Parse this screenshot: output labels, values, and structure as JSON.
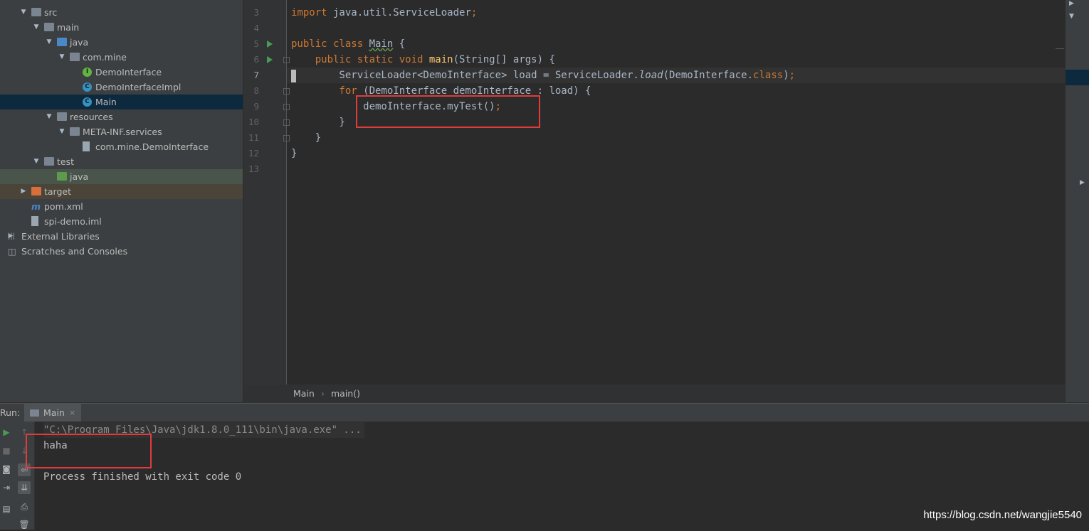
{
  "project_tree": [
    {
      "label": "src",
      "indent": 1,
      "type": "folder",
      "arrow": "down"
    },
    {
      "label": "main",
      "indent": 2,
      "type": "folder",
      "arrow": "down"
    },
    {
      "label": "java",
      "indent": 3,
      "type": "folder-blue",
      "arrow": "down"
    },
    {
      "label": "com.mine",
      "indent": 4,
      "type": "package",
      "arrow": "down"
    },
    {
      "label": "DemoInterface",
      "indent": 5,
      "type": "interface"
    },
    {
      "label": "DemoInterfaceImpl",
      "indent": 5,
      "type": "class"
    },
    {
      "label": "Main",
      "indent": 5,
      "type": "class-main",
      "selected": true
    },
    {
      "label": "resources",
      "indent": 3,
      "type": "folder",
      "arrow": "down"
    },
    {
      "label": "META-INF.services",
      "indent": 4,
      "type": "folder",
      "arrow": "down"
    },
    {
      "label": "com.mine.DemoInterface",
      "indent": 5,
      "type": "file"
    },
    {
      "label": "test",
      "indent": 2,
      "type": "folder",
      "arrow": "down"
    },
    {
      "label": "java",
      "indent": 3,
      "type": "folder-green",
      "highlight": "test"
    },
    {
      "label": "target",
      "indent": 1,
      "type": "folder-orange",
      "arrow": "right",
      "highlight": "target"
    },
    {
      "label": "pom.xml",
      "indent": 1,
      "type": "maven"
    },
    {
      "label": "spi-demo.iml",
      "indent": 1,
      "type": "file"
    },
    {
      "label": "External Libraries",
      "indent": 0,
      "type": "libs",
      "arrow": "right"
    },
    {
      "label": "Scratches and Consoles",
      "indent": 0,
      "type": "scratch"
    }
  ],
  "editor": {
    "line_numbers": [
      "3",
      "4",
      "5",
      "6",
      "7",
      "8",
      "9",
      "10",
      "11",
      "12",
      "13"
    ],
    "current_line": "7",
    "lines": {
      "l3_kw": "import",
      "l3_rest": " java.util.ServiceLoader",
      "l3_semi": ";",
      "l5_kw": "public class ",
      "l5_name": "Main",
      "l5_rest": " {",
      "l6_kw": "    public static void ",
      "l6_fn": "main",
      "l6_rest": "(String[] args) {",
      "l7_a": "        ServiceLoader<DemoInterface> load = ServiceLoader.",
      "l7_it": "load",
      "l7_b": "(DemoInterface.",
      "l7_kw": "class",
      "l7_c": ")",
      "l7_semi": ";",
      "l8_kw": "        for",
      "l8_rest": " (DemoInterface demoInterface : load) {",
      "l9_a": "            demoInterface.myTest()",
      "l9_semi": ";",
      "l10": "        }",
      "l11": "    }",
      "l12": "}"
    }
  },
  "breadcrumb": {
    "item1": "Main",
    "sep": "›",
    "item2": "main()"
  },
  "run_panel": {
    "label": "Run:",
    "tab": "Main",
    "tab_close": "×",
    "console": {
      "command": "\"C:\\Program Files\\Java\\jdk1.8.0_111\\bin\\java.exe\" ...",
      "output": "haha",
      "exit": "Process finished with exit code 0"
    }
  },
  "watermark": "https://blog.csdn.net/wangjie5540",
  "colors": {
    "keyword": "#cc7832",
    "function": "#ffc66d",
    "text": "#a9b7c6",
    "highlight_box": "#e03c3c",
    "run_icon": "#499c54"
  }
}
